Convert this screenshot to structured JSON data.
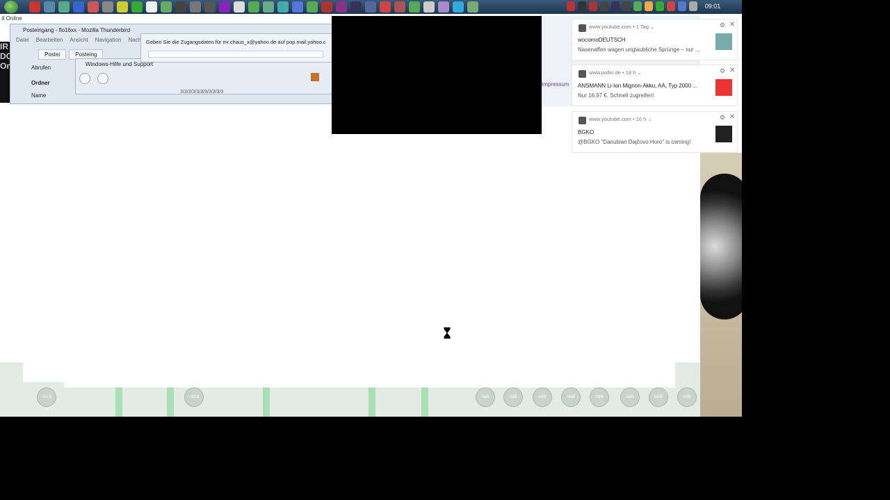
{
  "taskbar": {
    "clock": "09:01",
    "icons": [
      "#c33",
      "#58a",
      "#5a8",
      "#36c",
      "#c55",
      "#888",
      "#cc3",
      "#3a3",
      "#eee",
      "#6a6",
      "#444",
      "#777",
      "#555",
      "#82b",
      "#ddd",
      "#5a5",
      "#6a8",
      "#4aa",
      "#57d",
      "#5a5",
      "#a33",
      "#838",
      "#335",
      "#569",
      "#c44",
      "#a55",
      "#5a5",
      "#ccc",
      "#a8c",
      "#3ad",
      "#7a7"
    ],
    "tray_icons": [
      "#b33",
      "#333",
      "#a33",
      "#444",
      "#335",
      "#444",
      "#5a5",
      "#ea4",
      "#3a3",
      "#c44",
      "#57c",
      "#aaa"
    ]
  },
  "status": {
    "online": "4 Online"
  },
  "thunderbird": {
    "title": "Posteingang - flo16xx - Mozilla Thunderbird",
    "menu": [
      "Datei",
      "Bearbeiten",
      "Ansicht",
      "Navigation",
      "Nachr"
    ],
    "tabs": [
      "Postei",
      "Posteing"
    ],
    "toolbar_label": "Abrufen",
    "folder_header": "Ordner",
    "column_name": "Name",
    "side_text": "IR\nDC\nOr"
  },
  "help_window": {
    "title": "Windows-Hilfe und Support",
    "search_text": "3/3/3/3/3/3/3/3/3/3/3"
  },
  "dialog": {
    "message": "Geben Sie die Zugangsdaten für mr.chaus_x@yahoo.de auf pop.mail.yahoo.c"
  },
  "background_page": {
    "impressum": "Impressum"
  },
  "notifications": [
    {
      "source": "www.youtube.com",
      "age": "1 Tag",
      "title": "wocomoDEUTSCH",
      "body": "Nasenaffen wagen unglaubliche Sprünge – nur ...",
      "thumb_color": "#7aa"
    },
    {
      "source": "www.pollin.de",
      "age": "18 h",
      "title": "ANSMANN Li-Ion Mignon-Akku, AA, Typ 2000 ...",
      "body": "Nur 16,97 €. Schnell zugreifen!",
      "thumb_color": "#e33"
    },
    {
      "source": "www.youtube.com",
      "age": "16 h",
      "title": "BGKO",
      "body": "@BGKO \"Danubian Dajčovo Horo\" is coming!",
      "thumb_color": "#222"
    }
  ],
  "mixer": {
    "knobs": [
      "-32.8",
      "-30.6",
      "0dB",
      "0dB",
      "0dB",
      "0dB",
      "0dB",
      "0dB",
      "0dB",
      "0dB"
    ]
  }
}
